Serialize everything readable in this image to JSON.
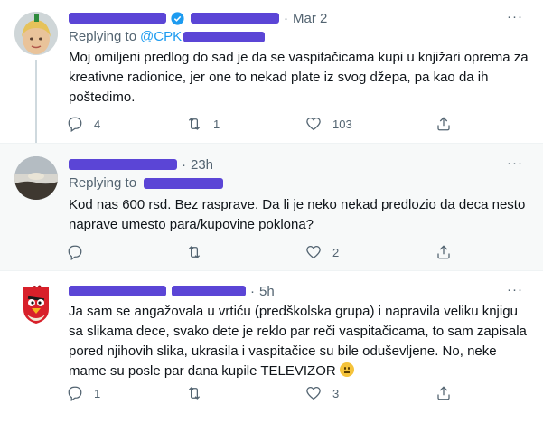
{
  "tweets": [
    {
      "time": "Mar 2",
      "replying_label": "Replying to",
      "replying_handle": "@CPK",
      "text": "Moj omiljeni predlog do sad je da se vaspitačicama kupi u knjižari oprema za kreativne radionice, jer one to nekad plate iz svog džepa, pa kao da ih poštedimo.",
      "reply_count": "4",
      "retweet_count": "1",
      "like_count": "103"
    },
    {
      "time": "23h",
      "replying_label": "Replying to",
      "replying_handle": "",
      "text": "Kod nas 600 rsd. Bez rasprave. Da li je neko nekad predlozio da deca nesto naprave umesto para/kupovine poklona?",
      "reply_count": "",
      "retweet_count": "",
      "like_count": "2"
    },
    {
      "time": "5h",
      "text": "Ja sam se angažovala u vrtiću (predškolska grupa) i napravila veliku knjigu sa slikama dece, svako dete je  reklo par reči vaspitačicama, to sam zapisala pored njihovih slika, ukrasila i vaspitačice su bile oduševljene. No, neke mame su posle par dana kupile TELEVIZOR",
      "reply_count": "1",
      "retweet_count": "",
      "like_count": "3"
    }
  ],
  "ui": {
    "separator": "·",
    "more": "···"
  },
  "colors": {
    "accent": "#1d9bf0",
    "text": "#0f1419",
    "muted": "#536471",
    "redaction": "#5b45d6",
    "highlight_bg": "#f7f9f9"
  },
  "icons": [
    "avatar-photo",
    "verified-badge-icon",
    "more-icon",
    "reply-icon",
    "retweet-icon",
    "like-icon",
    "share-icon",
    "neutral-face-emoji",
    "angry-birds-avatar"
  ]
}
